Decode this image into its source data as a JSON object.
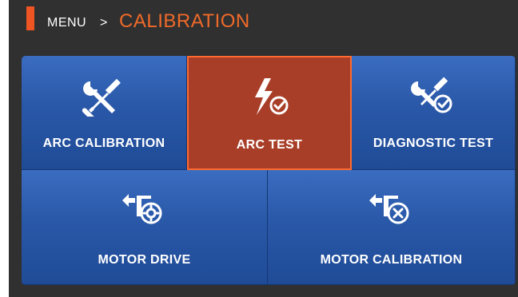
{
  "header": {
    "breadcrumb_parent": "MENU",
    "breadcrumb_separator": ">",
    "title": "CALIBRATION"
  },
  "tiles": [
    {
      "label": "ARC CALIBRATION",
      "icon": "wrench-screwdriver-icon",
      "selected": false
    },
    {
      "label": "ARC TEST",
      "icon": "lightning-check-icon",
      "selected": true
    },
    {
      "label": "DIAGNOSTIC TEST",
      "icon": "tools-check-icon",
      "selected": false
    },
    {
      "label": "MOTOR DRIVE",
      "icon": "motor-gear-icon",
      "selected": false
    },
    {
      "label": "MOTOR CALIBRATION",
      "icon": "motor-tools-icon",
      "selected": false
    }
  ],
  "colors": {
    "background": "#303030",
    "accent": "#ee5522",
    "tile": "#2a58a8",
    "selected_tile": "#a83e28"
  }
}
